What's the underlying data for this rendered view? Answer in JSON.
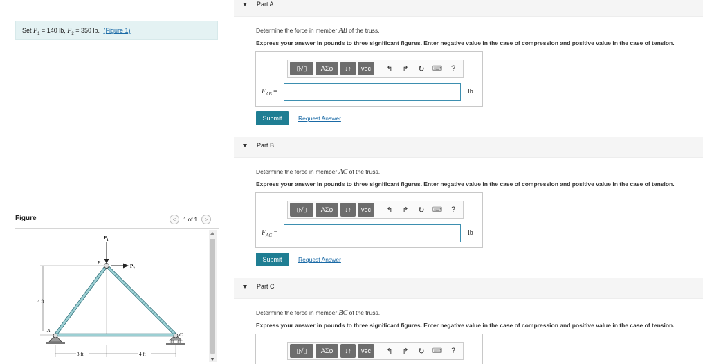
{
  "problem": {
    "text_prefix": "Set ",
    "p1_sym": "P",
    "p1_sub": "1",
    "p1_val": " = 140 lb, ",
    "p2_sym": "P",
    "p2_sub": "2",
    "p2_val": " = 350 lb. ",
    "figure_link": "(Figure 1)"
  },
  "figure": {
    "title": "Figure",
    "page_indicator": "1 of 1",
    "labels": {
      "p1": "P",
      "p1_sub": "1",
      "p2": "P",
      "p2_sub": "2",
      "b": "B",
      "a": "A",
      "c": "C",
      "height": "4 ft",
      "span_left": "3 ft",
      "span_right": "4 ft"
    }
  },
  "parts": [
    {
      "title": "Part A",
      "q_prefix": "Determine the force in member ",
      "member": "AB",
      "q_suffix": " of the truss.",
      "instruction": "Express your answer in pounds to three significant figures. Enter negative value in the case of compression and positive value in the case of tension.",
      "var": "F",
      "var_sub": "AB",
      "eq": " =",
      "unit": "lb",
      "submit": "Submit",
      "request": "Request Answer"
    },
    {
      "title": "Part B",
      "q_prefix": "Determine the force in member ",
      "member": "AC",
      "q_suffix": " of the truss.",
      "instruction": "Express your answer in pounds to three significant figures. Enter negative value in the case of compression and positive value in the case of tension.",
      "var": "F",
      "var_sub": "AC",
      "eq": " =",
      "unit": "lb",
      "submit": "Submit",
      "request": "Request Answer"
    },
    {
      "title": "Part C",
      "q_prefix": "Determine the force in member ",
      "member": "BC",
      "q_suffix": " of the truss.",
      "instruction": "Express your answer in pounds to three significant figures. Enter negative value in the case of compression and positive value in the case of tension."
    }
  ],
  "toolbar": {
    "templates": "▯√▯",
    "greek": "ΑΣφ",
    "updown": "↓↑",
    "vec": "vec",
    "undo": "↰",
    "redo": "↱",
    "reset": "↻",
    "keyboard": "⌨",
    "help": "?"
  }
}
